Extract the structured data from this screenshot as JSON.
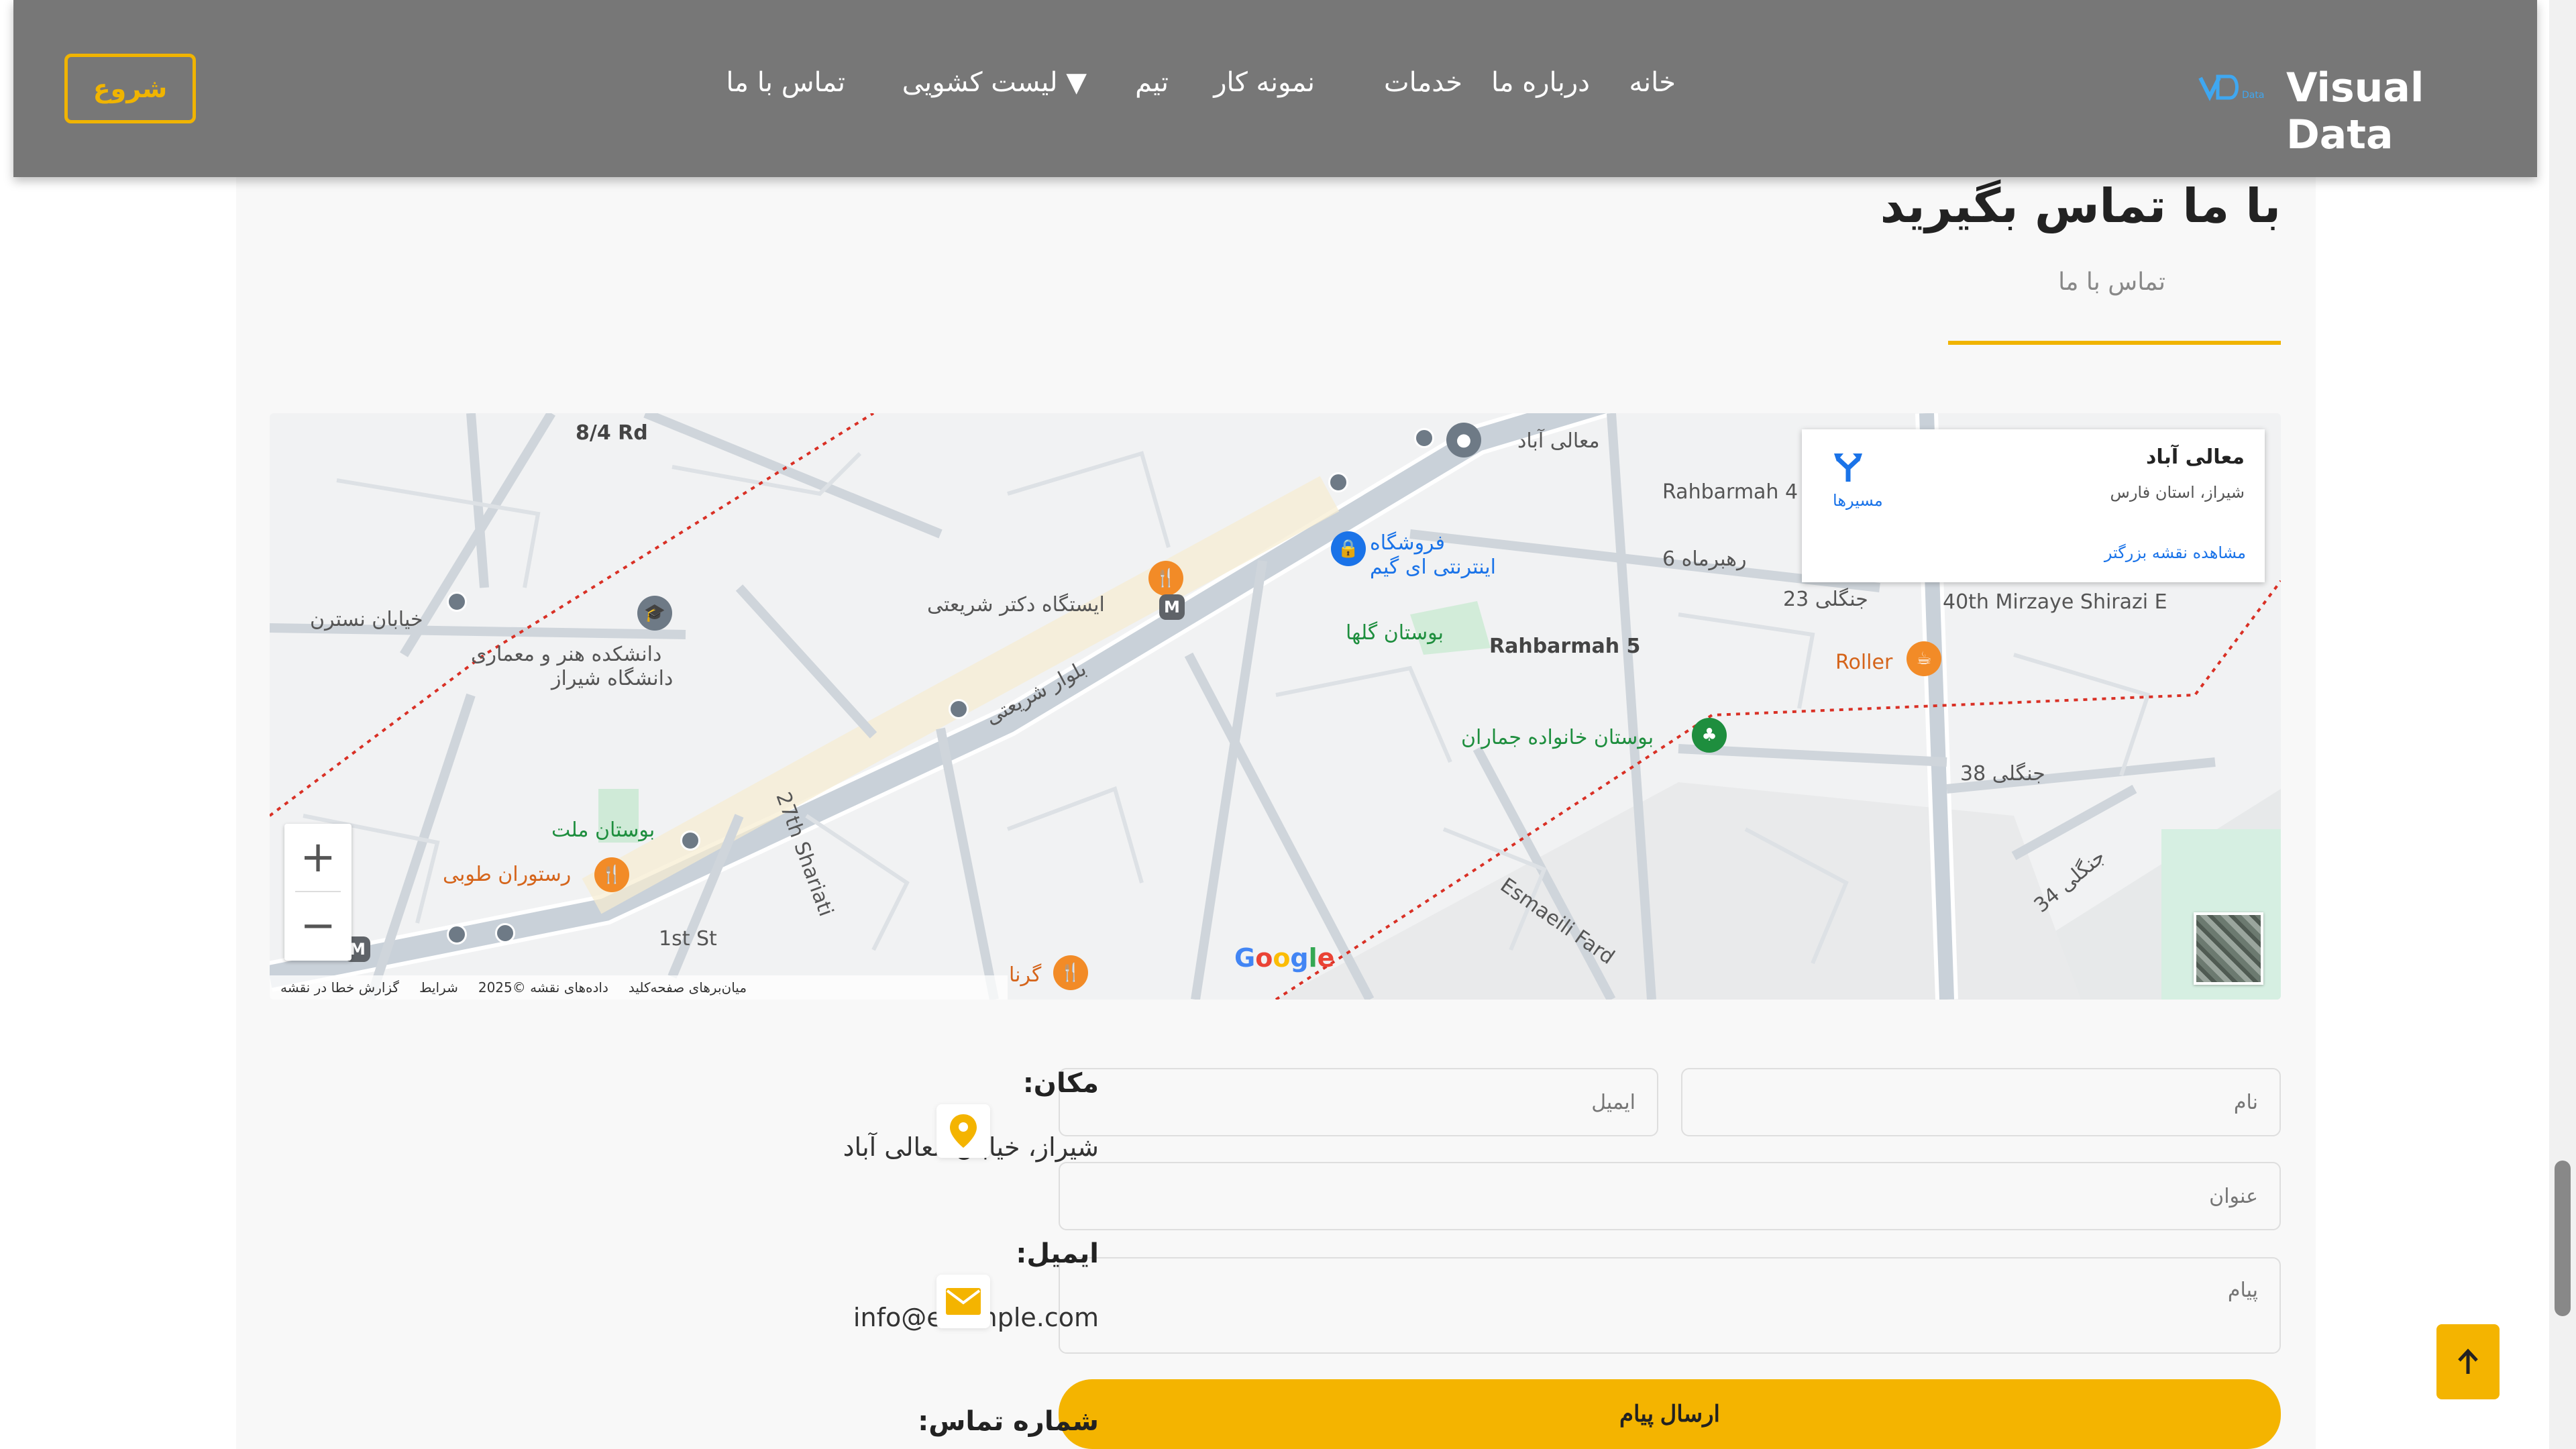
{
  "header": {
    "logo_text": "Visual Data",
    "logo_icon": "visual-data-logo",
    "start_button": "شروع",
    "nav": [
      "خانه",
      "درباره ما",
      "خدمات",
      "نمونه کار",
      "تیم",
      "لیست کشویی ▼",
      "تماس با ما"
    ]
  },
  "contact": {
    "title": "با ما تماس بگیرید",
    "subtitle": "تماس با ما"
  },
  "map": {
    "infocard_title": "معالی آباد",
    "infocard_address": "شیراز، استان فارس",
    "directions_label": "مسیرها",
    "larger_map_link": "مشاهده نقشه بزرگتر",
    "labels": {
      "road_8_4": "8/4 Rd",
      "maali_abad": "معالی آباد",
      "rahbarmah4": "Rahbarmah 4",
      "rahbarmah6": "رهبرماه 6",
      "jangali23": "23 جنگلی",
      "mirzaye40": "40th Mirzaye Shirazi E",
      "roller": "Roller",
      "store_line1": "فروشگاه",
      "store_line2": "اینترنتی ای گیم",
      "golha_park": "بوستان گلها",
      "rahbarmah5": "Rahbarmah 5",
      "jamaran_park": "بوستان خانواده جماران",
      "dr_shariati_station": "ایستگاه دکتر شریعتی",
      "art_faculty_line1": "دانشکده هنر و معماری",
      "art_faculty_line2": "دانشگاه شیراز",
      "nastaran": "خیابان نسترن",
      "mellat_park": "بوستان ملت",
      "tooba_restaurant": "رستوران طوبی",
      "shariati_27": "27th Shariati",
      "st_1": "1st St",
      "gerna": "گرنا",
      "jangali38": "جنگلی 38",
      "jangali34": "جنگلی 34",
      "esmaeili_fard": "Esmaeili Fard",
      "boulevard_shariati": "بلوار شریعتی"
    },
    "google": "Google",
    "zoom_in": "+",
    "zoom_out": "−",
    "footer": [
      "میان‌برهای صفحه‌کلید",
      "داده‌های نقشه ©2025",
      "شرایط",
      "گزارش خطا در نقشه"
    ]
  },
  "form": {
    "name_placeholder": "نام",
    "email_placeholder": "ایمیل",
    "subject_placeholder": "عنوان",
    "message_placeholder": "پیام",
    "submit_label": "ارسال پیام"
  },
  "info": {
    "location_label": "مکان:",
    "location_value": "شیراز، خیابان معالی آباد",
    "email_label": "ایمیل:",
    "email_value": "info@example.com",
    "phone_label": "شماره تماس:"
  },
  "colors": {
    "accent": "#f4b400",
    "header_bg": "#777777"
  }
}
